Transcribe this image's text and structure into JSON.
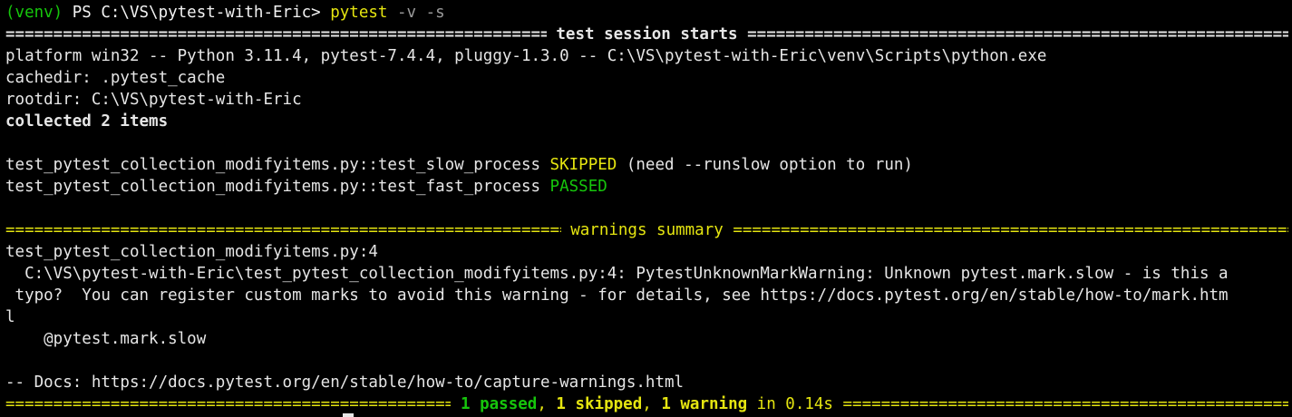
{
  "colors": {
    "background": "#000000",
    "text": "#e6e6e6",
    "green": "#16c60c",
    "yellow": "#e5e510"
  },
  "prompt": {
    "venv": "(venv)",
    "ps": " PS C:\\VS\\pytest-with-Eric> ",
    "command": "pytest",
    "args": " -v -s"
  },
  "session_header": " test session starts ",
  "platform_line": "platform win32 -- Python 3.11.4, pytest-7.4.4, pluggy-1.3.0 -- C:\\VS\\pytest-with-Eric\\venv\\Scripts\\python.exe",
  "cachedir_line": "cachedir: .pytest_cache",
  "rootdir_line": "rootdir: C:\\VS\\pytest-with-Eric",
  "collected_line": "collected 2 items",
  "results": [
    {
      "name": "test_pytest_collection_modifyitems.py::test_slow_process ",
      "status": "SKIPPED",
      "reason": " (need --runslow option to run)"
    },
    {
      "name": "test_pytest_collection_modifyitems.py::test_fast_process ",
      "status": "PASSED",
      "reason": ""
    }
  ],
  "warnings_header": " warnings summary ",
  "warning_file": "test_pytest_collection_modifyitems.py:4",
  "warning_message_lines": [
    "  C:\\VS\\pytest-with-Eric\\test_pytest_collection_modifyitems.py:4: PytestUnknownMarkWarning: Unknown pytest.mark.slow - is this a",
    " typo?  You can register custom marks to avoid this warning - for details, see https://docs.pytest.org/en/stable/how-to/mark.htm",
    "l"
  ],
  "warning_code": "    @pytest.mark.slow",
  "docs_line": "-- Docs: https://docs.pytest.org/en/stable/how-to/capture-warnings.html",
  "summary": {
    "passed": "1 passed",
    "sep1": ", ",
    "skipped": "1 skipped",
    "sep2": ", ",
    "warning": "1 warning",
    "time": " in 0.14s "
  }
}
